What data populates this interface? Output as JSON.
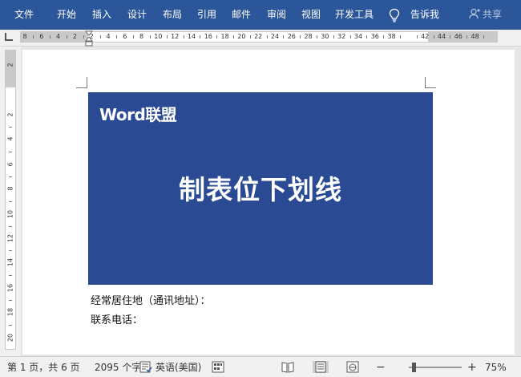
{
  "ribbon": {
    "background": "#2b579a",
    "tabs": [
      "文件",
      "开始",
      "插入",
      "设计",
      "布局",
      "引用",
      "邮件",
      "审阅",
      "视图",
      "开发工具"
    ],
    "tell_me": "告诉我",
    "share": "共享"
  },
  "ruler": {
    "horizontal": [
      "8",
      "6",
      "4",
      "2",
      "2",
      "4",
      "6",
      "8",
      "10",
      "12",
      "14",
      "16",
      "18",
      "20",
      "22",
      "24",
      "26",
      "28",
      "30",
      "32",
      "34",
      "36",
      "38",
      "42",
      "44",
      "46",
      "48"
    ],
    "vertical": [
      "2",
      "2",
      "4",
      "6",
      "8",
      "10",
      "12",
      "14",
      "16",
      "18",
      "20"
    ]
  },
  "document": {
    "banner": {
      "background": "#2a4b94",
      "logo": "Word联盟",
      "title": "制表位下划线"
    },
    "lines": [
      "经常居住地（通讯地址）：",
      "联系电话："
    ]
  },
  "status": {
    "page": "第 1 页，共 6 页",
    "words": "2095 个字",
    "language": "英语(美国)",
    "zoom": "75%",
    "zoom_minus": "−",
    "zoom_plus": "+"
  }
}
